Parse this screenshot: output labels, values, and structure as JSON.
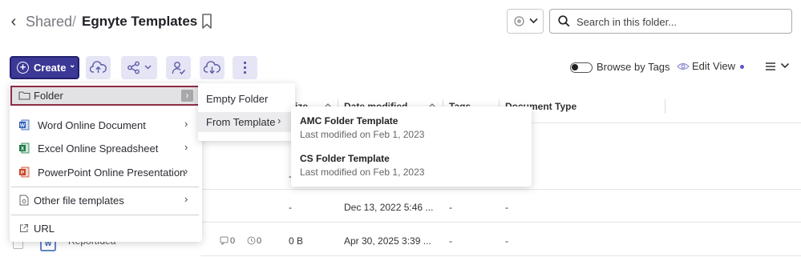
{
  "breadcrumb": {
    "parent": "Shared",
    "separator": "/",
    "current": "Egnyte Templates"
  },
  "search": {
    "placeholder": "Search in this folder...",
    "value": ""
  },
  "toolbar": {
    "create_label": "Create"
  },
  "browse_by_tags": {
    "label": "Browse by Tags",
    "enabled": false
  },
  "edit_view_label": "Edit View",
  "accent_color": "#3b3896",
  "columns": [
    "ize",
    "Date modified",
    "Tags",
    "Document Type"
  ],
  "rows": [
    {
      "size": "-",
      "date": "Dec 13, 2022 5:46 ...",
      "tags": "-",
      "type": "-"
    },
    {
      "name": "ReportIdea",
      "comments": "0",
      "versions": "0",
      "size": "0 B",
      "date": "Apr 30, 2025 3:39 ...",
      "tags": "-",
      "type": "-"
    }
  ],
  "extra_cells": {
    "dash_a": "-",
    "dash_b": "-"
  },
  "create_menu": {
    "folder": "Folder",
    "word": "Word Online Document",
    "excel": "Excel Online Spreadsheet",
    "powerpoint": "PowerPoint Online Presentation",
    "other": "Other file templates",
    "url": "URL"
  },
  "folder_submenu": {
    "empty": "Empty Folder",
    "from_template": "From Template"
  },
  "templates": [
    {
      "name": "AMC Folder Template",
      "modified": "Last modified on Feb 1, 2023"
    },
    {
      "name": "CS Folder Template",
      "modified": "Last modified on Feb 1, 2023"
    }
  ]
}
